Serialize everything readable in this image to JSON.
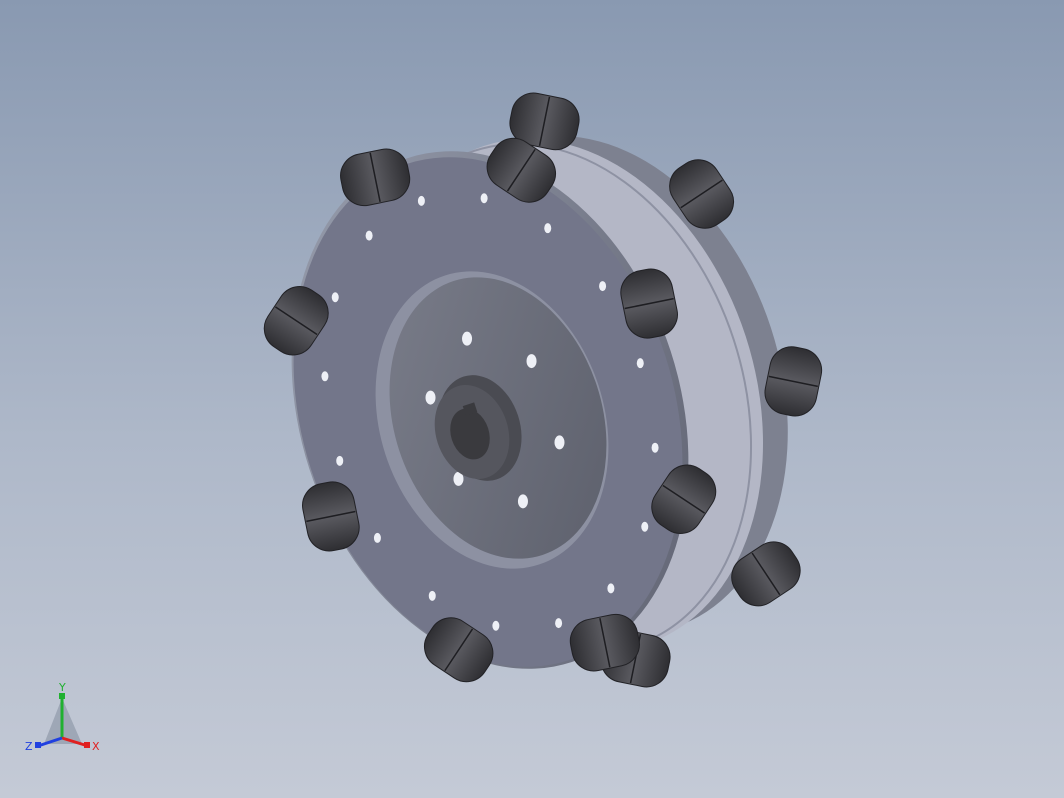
{
  "view": {
    "background_top": "#8999b1",
    "background_bottom": "#c4cad6",
    "model": "omni-wheel"
  },
  "colors": {
    "hub_face": "#6b6e7a",
    "hub_rim": "#8a8e9e",
    "roller": "#3c3c40",
    "roller_light": "#6a6a70",
    "shaft_bore": "#3a3a3e"
  },
  "triad": {
    "x_label": "X",
    "y_label": "Y",
    "z_label": "Z",
    "x_color": "#e02020",
    "y_color": "#20b030",
    "z_color": "#2040e0"
  }
}
